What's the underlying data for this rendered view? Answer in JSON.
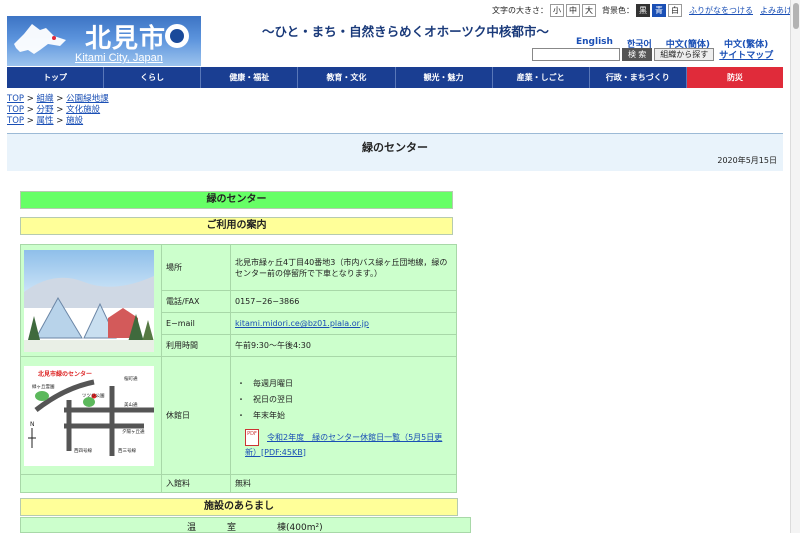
{
  "header": {
    "logo_city": "北見市",
    "logo_city_en": "Kitami City, Japan",
    "tagline": "～ひと・まち・自然きらめくオホーツク中核都市～"
  },
  "utility": {
    "font_size_label": "文字の大きさ：",
    "font_small": "小",
    "font_medium": "中",
    "font_large": "大",
    "bg_label": "背景色：",
    "bg_black": "黒",
    "bg_blue": "青",
    "bg_white": "白",
    "furigana": "ふりがなをつける",
    "read_aloud": "よみあげる"
  },
  "languages": [
    "English",
    "한국어",
    "中文(簡体)",
    "中文(繁体)"
  ],
  "search": {
    "placeholder": "",
    "search_button": "検 索",
    "org_button": "組織から探す",
    "sitemap": "サイトマップ"
  },
  "nav": [
    "トップ",
    "くらし",
    "健康・福祉",
    "教育・文化",
    "観光・魅力",
    "産業・しごと",
    "行政・まちづくり",
    "防災"
  ],
  "breadcrumbs": [
    [
      "TOP",
      "組織",
      "公園緑地課"
    ],
    [
      "TOP",
      "分野",
      "文化施設"
    ],
    [
      "TOP",
      "属性",
      "施設"
    ]
  ],
  "page": {
    "title": "緑のセンター",
    "date": "2020年5月15日"
  },
  "content": {
    "facility_heading": "緑のセンター",
    "guide_heading": "ご利用の案内",
    "info": {
      "address_label": "場所",
      "address_value": "北見市緑ヶ丘4丁目40番地3（市内バス緑ヶ丘団地線，緑のセンター前の停留所で下車となります。）",
      "tel_label": "電話/FAX",
      "tel_value": "0157−26−3866",
      "email_label": "E−mail",
      "email_value": "kitami.midori.ce@bz01.plala.or.jp",
      "hours_label": "利用時間",
      "hours_value": "午前9:30〜午後4:30",
      "closed_label": "休館日",
      "closed_items": [
        "・　毎週月曜日",
        "・　祝日の翌日",
        "・　年末年始"
      ],
      "pdf_icon_text": "PDF",
      "pdf_link": "令和2年度　緑のセンター休館日一覧（5月5日更新）[PDF:45KB]",
      "fee_label": "入館料",
      "fee_value": "無料"
    },
    "map": {
      "title": "北見市緑のセンター",
      "labels": [
        "緑ヶ丘霊園",
        "ツツジ公園",
        "桜町通",
        "美山通",
        "夕陽ヶ丘通",
        "西三号線",
        "西四号線"
      ]
    },
    "outline_heading": "施設のあらまし",
    "outline_row": {
      "col1": "温",
      "col2": "室",
      "col3": "棟(400m²)"
    }
  }
}
